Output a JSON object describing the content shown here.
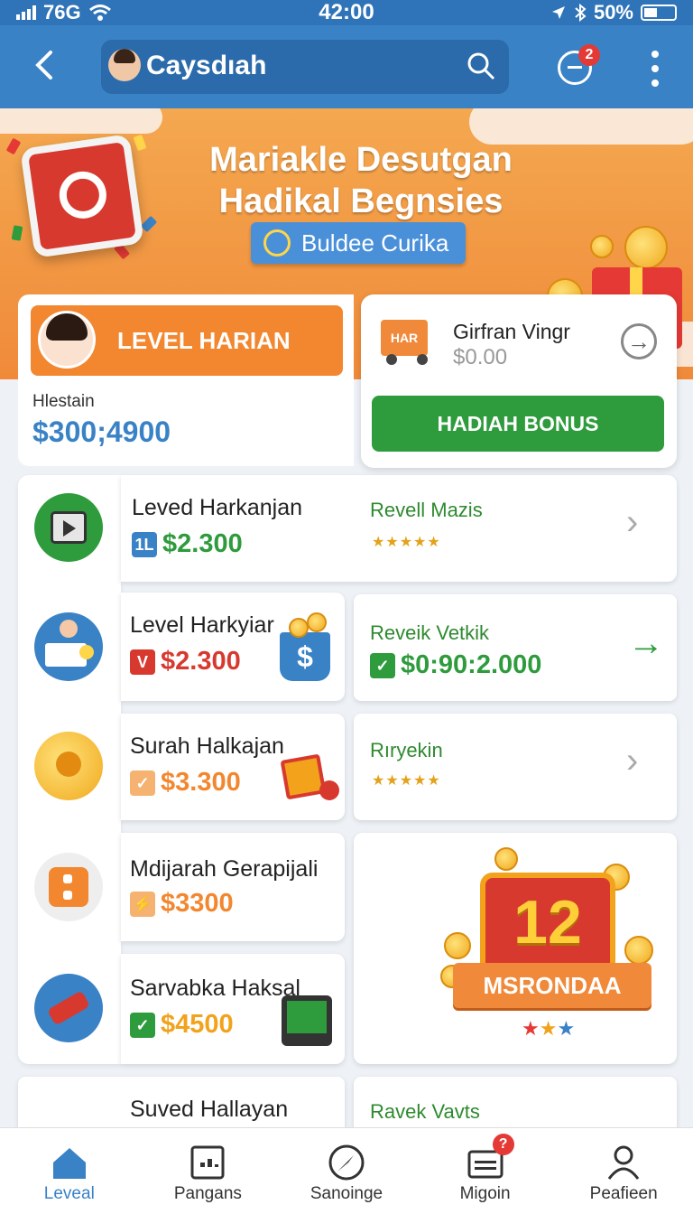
{
  "status_bar": {
    "network": "76G",
    "time": "42:00",
    "battery": "50%"
  },
  "header": {
    "title": "Caysdıah",
    "chat_badge": "2"
  },
  "banner": {
    "title_line1": "Mariakle Desutgan",
    "title_line2": "Hadikal Begnsies",
    "cta_label": "Buldee Curika"
  },
  "level_card": {
    "pill_label": "LEVEL HARIAN",
    "balance_label": "Hlestain",
    "balance_value": "$300;4900"
  },
  "gift_card": {
    "title": "Girfran Vingr",
    "amount": "$0.00",
    "truck_text": "HAR",
    "button_label": "HADIAH BONUS"
  },
  "rows": [
    {
      "title": "Leved Harkanjan",
      "tag": "1L",
      "price": "$2.300",
      "right_label": "Revell Mazis",
      "right_stars": "★★★★★"
    },
    {
      "title": "Level Harkyiar",
      "tag": "V",
      "price": "$2.300",
      "right_label": "Reveik Vetkik",
      "right_value": "$0:90:2.000"
    },
    {
      "title": "Surah Halkajan",
      "tag": "✓",
      "price": "$3.300",
      "right_label": "Rıryekin",
      "right_stars": "★★★★★"
    },
    {
      "title": "Mdijarah Gerapijali",
      "tag": "⚡",
      "price": "$3300"
    },
    {
      "title": "Sarvabka Haksal",
      "tag": "✓",
      "price": "$4500"
    },
    {
      "title": "Suved Hallayan",
      "right_label": "Ravek Vavts"
    }
  ],
  "promo": {
    "number": "12",
    "ribbon": "MSRONDAA"
  },
  "bottom_nav": [
    {
      "label": "Leveal",
      "icon": "home-icon"
    },
    {
      "label": "Pangans",
      "icon": "grid-icon"
    },
    {
      "label": "Sanoinge",
      "icon": "compass-icon"
    },
    {
      "label": "Migoin",
      "icon": "inbox-icon",
      "badge": "?"
    },
    {
      "label": "Peafieen",
      "icon": "user-icon"
    }
  ],
  "colors": {
    "primary": "#3a82c6",
    "accent": "#f2872f",
    "green": "#2e9b3c",
    "red": "#d8392f"
  }
}
